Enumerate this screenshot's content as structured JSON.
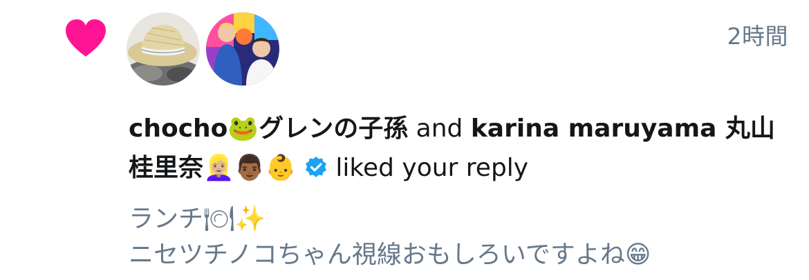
{
  "notification": {
    "timestamp": "2時間",
    "user1_name": "chocho🐸グレンの子孫",
    "connector": " and ",
    "user2_name": "karina maruyama 丸山桂里奈👱🏼‍♀️👨🏾👶",
    "action": " liked your reply",
    "tweet_lines": [
      "ランチ🍽✨",
      "ニセツチノコちゃん視線おもしろいですよね😁"
    ]
  },
  "colors": {
    "heart": "#ff1493",
    "verified": "#1da1f2",
    "primary_text": "#14171a",
    "secondary_text": "#66788a"
  },
  "icons": {
    "like": "heart-icon",
    "verified": "verified-badge-icon"
  }
}
